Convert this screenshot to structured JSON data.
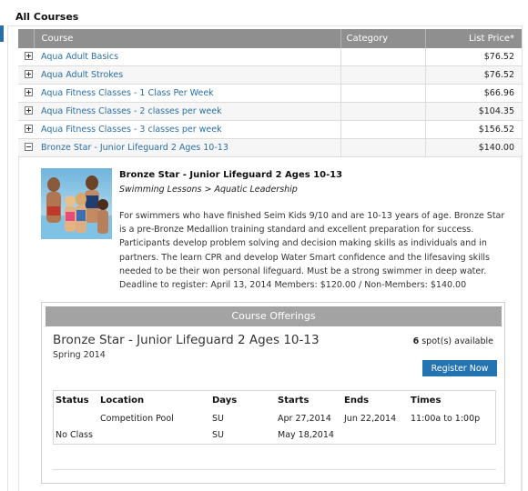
{
  "page": {
    "section_title": "All Courses"
  },
  "table": {
    "headers": {
      "course": "Course",
      "category": "Category",
      "price": "List Price*"
    },
    "rows": [
      {
        "name": "Aqua Adult Basics",
        "category": "",
        "price": "$76.52",
        "expanded": false
      },
      {
        "name": "Aqua Adult Strokes",
        "category": "",
        "price": "$76.52",
        "expanded": false
      },
      {
        "name": "Aqua Fitness Classes - 1 Class Per Week",
        "category": "",
        "price": "$66.96",
        "expanded": false
      },
      {
        "name": "Aqua Fitness Classes - 2 classes per week",
        "category": "",
        "price": "$104.35",
        "expanded": false
      },
      {
        "name": "Aqua Fitness Classes - 3 classes per week",
        "category": "",
        "price": "$156.52",
        "expanded": false
      },
      {
        "name": "Bronze Star - Junior Lifeguard 2 Ages 10-13",
        "category": "",
        "price": "$140.00",
        "expanded": true
      }
    ]
  },
  "detail": {
    "title": "Bronze Star - Junior Lifeguard 2 Ages 10-13",
    "breadcrumb": "Swimming Lessons > Aquatic Leadership",
    "description": "For swimmers who have finished Seim Kids 9/10 and are 10-13 years of age. Bronze Star is a pre-Bronze Medallion training standard and excellent preparation for success. Participants develop problem solving and decision making skills as individuals and in partners. The learn CPR and develop Water Smart confidence and the lifesaving skills needed to be their won personal lifeguard. Must be a strong swimmer in deep water. Deadline to register: April 13, 2014 Members: $120.00 / Non-Members: $140.00"
  },
  "offerings": {
    "header": "Course Offerings",
    "name": "Bronze Star - Junior Lifeguard 2 Ages 10-13",
    "term": "Spring 2014",
    "spots_count": "6",
    "spots_text": "spot(s) available",
    "register_label": "Register Now",
    "columns": {
      "status": "Status",
      "location": "Location",
      "days": "Days",
      "starts": "Starts",
      "ends": "Ends",
      "times": "Times"
    },
    "schedule": [
      {
        "status": "",
        "location": "Competition Pool",
        "days": "SU",
        "starts": "Apr 27,2014",
        "ends": "Jun 22,2014",
        "times": "11:00a to 1:00p"
      },
      {
        "status": "No Class",
        "location": "",
        "days": "SU",
        "starts": "May 18,2014",
        "ends": "",
        "times": ""
      }
    ]
  },
  "icons": {
    "expand": "plus-square-icon",
    "collapse": "minus-square-icon",
    "photo": "family-photo"
  },
  "colors": {
    "link": "#2a6fa6",
    "header_bg": "#8f8f8f",
    "button": "#2474b2"
  }
}
